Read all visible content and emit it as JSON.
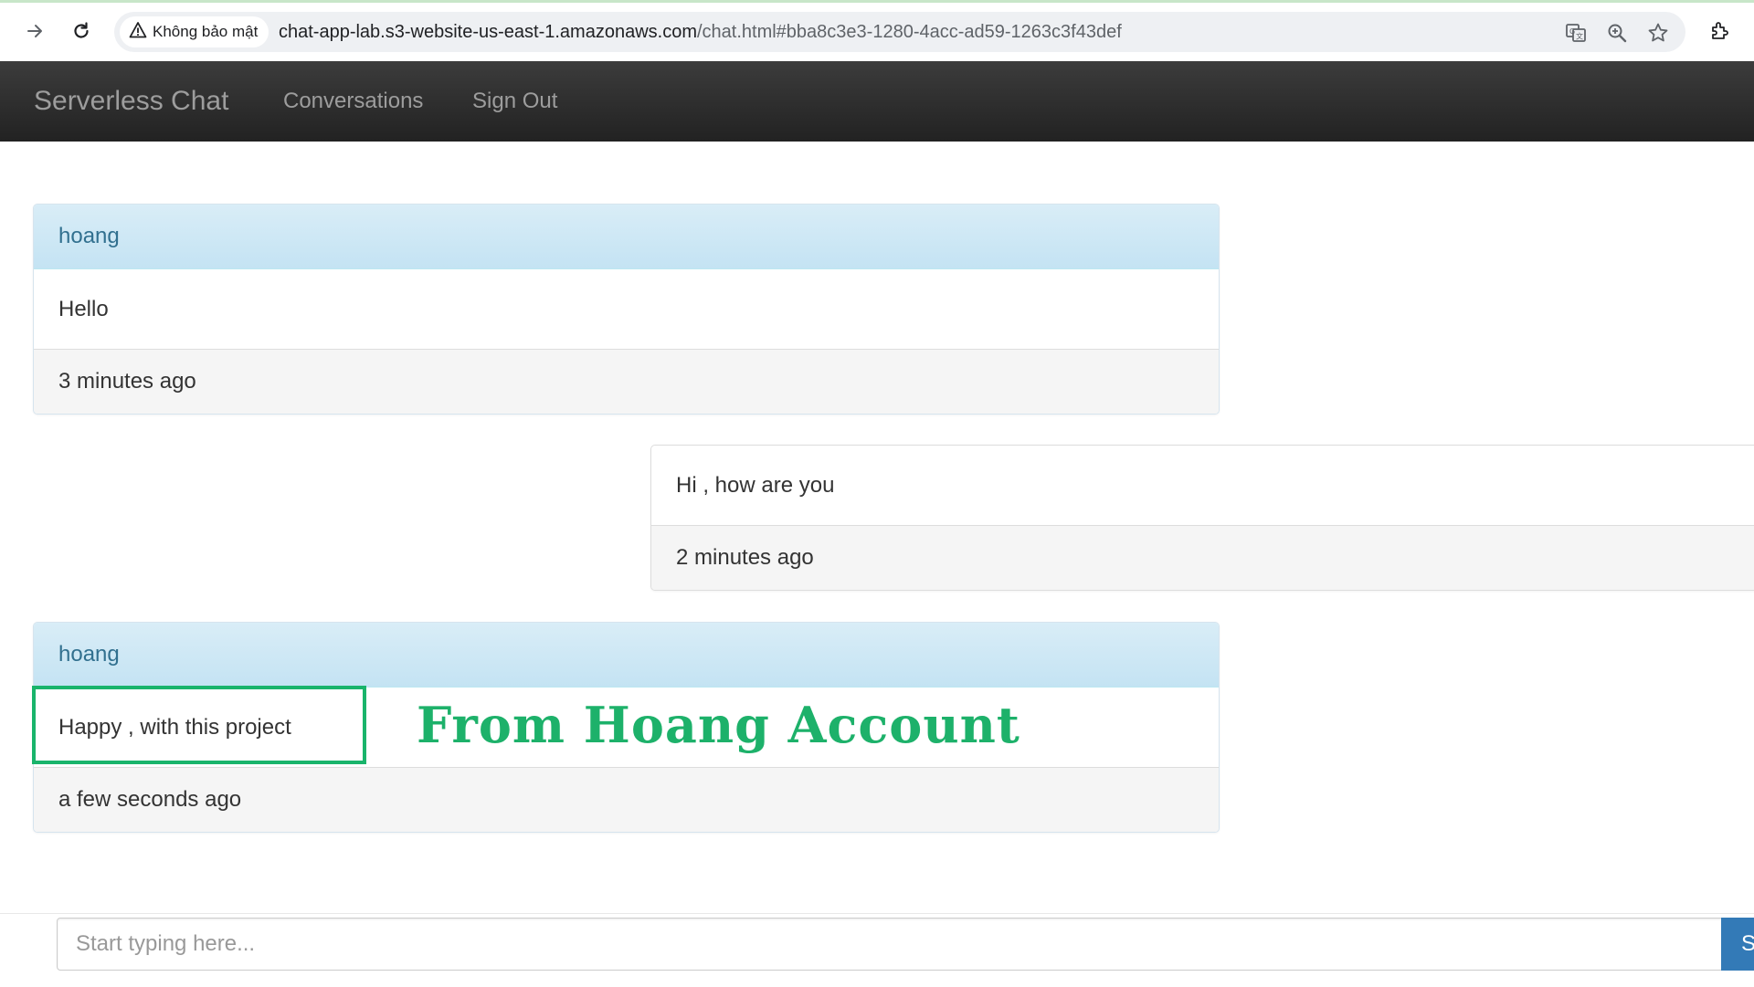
{
  "browser": {
    "security_label": "Không bảo mật",
    "url_host": "chat-app-lab.s3-website-us-east-1.amazonaws.com",
    "url_path": "/chat.html#bba8c3e3-1280-4acc-ad59-1263c3f43def"
  },
  "navbar": {
    "brand": "Serverless Chat",
    "conversations_label": "Conversations",
    "signout_label": "Sign Out"
  },
  "messages": [
    {
      "sender": "hoang",
      "text": "Hello",
      "time": "3 minutes ago",
      "side": "left"
    },
    {
      "sender": "",
      "text": "Hi , how are you",
      "time": "2 minutes ago",
      "side": "right"
    },
    {
      "sender": "hoang",
      "text": "Happy , with this project",
      "time": "a few seconds ago",
      "side": "left"
    }
  ],
  "annotation": {
    "text": "From Hoang Account",
    "color": "#1db16a"
  },
  "composer": {
    "placeholder": "Start typing here...",
    "send_label": "S"
  },
  "colors": {
    "navbar_bg": "#222222",
    "heading_bg": "#d9edf7",
    "heading_text": "#31708f",
    "send_button": "#337ab7",
    "highlight": "#19b46b"
  }
}
